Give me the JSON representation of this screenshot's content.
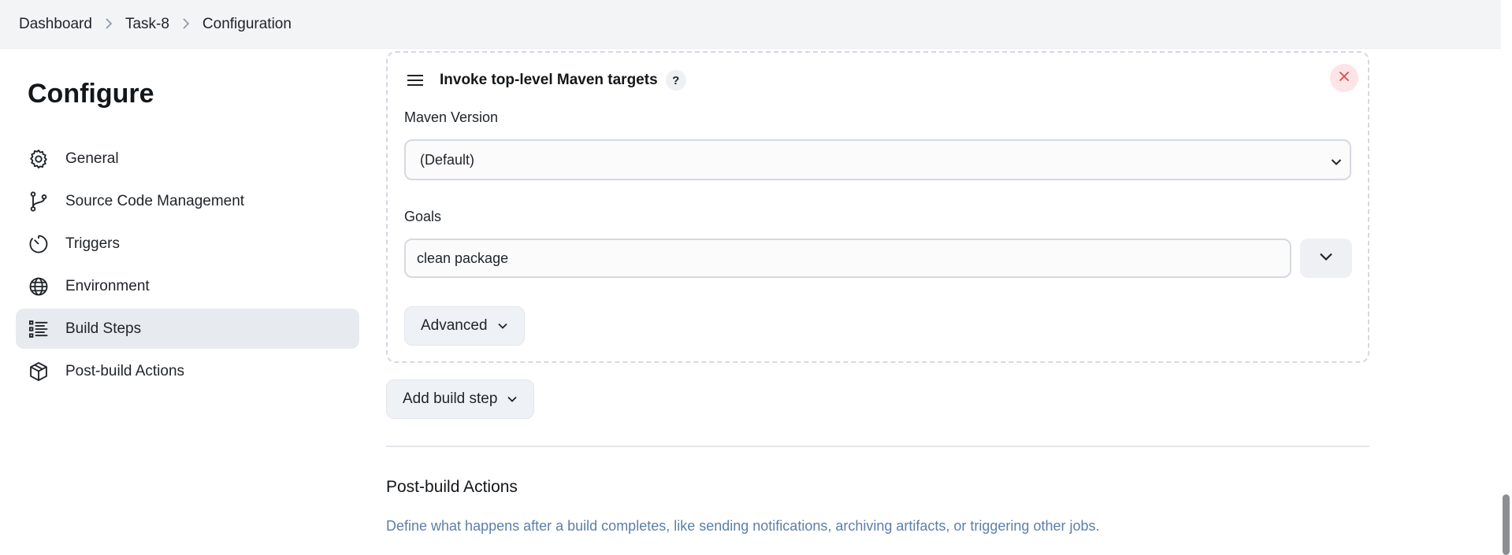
{
  "breadcrumb": {
    "items": [
      "Dashboard",
      "Task-8",
      "Configuration"
    ]
  },
  "sidebar": {
    "title": "Configure",
    "items": [
      {
        "label": "General",
        "icon": "gear-icon"
      },
      {
        "label": "Source Code Management",
        "icon": "branch-icon"
      },
      {
        "label": "Triggers",
        "icon": "timer-icon"
      },
      {
        "label": "Environment",
        "icon": "globe-icon"
      },
      {
        "label": "Build Steps",
        "icon": "list-icon",
        "active": true
      },
      {
        "label": "Post-build Actions",
        "icon": "package-icon"
      }
    ]
  },
  "build_step": {
    "title": "Invoke top-level Maven targets",
    "help_label": "?",
    "maven_version_label": "Maven Version",
    "maven_version_value": "(Default)",
    "goals_label": "Goals",
    "goals_value": "clean package",
    "advanced_label": "Advanced"
  },
  "add_build_step_label": "Add build step",
  "post_build": {
    "title": "Post-build Actions",
    "description": "Define what happens after a build completes, like sending notifications, archiving artifacts, or triggering other jobs."
  },
  "colors": {
    "topbar_bg": "#f3f4f6",
    "active_item_bg": "#e7eaef",
    "close_bg": "#fde4e6",
    "close_x": "#e5484d",
    "description_text": "#5b7fa8"
  }
}
